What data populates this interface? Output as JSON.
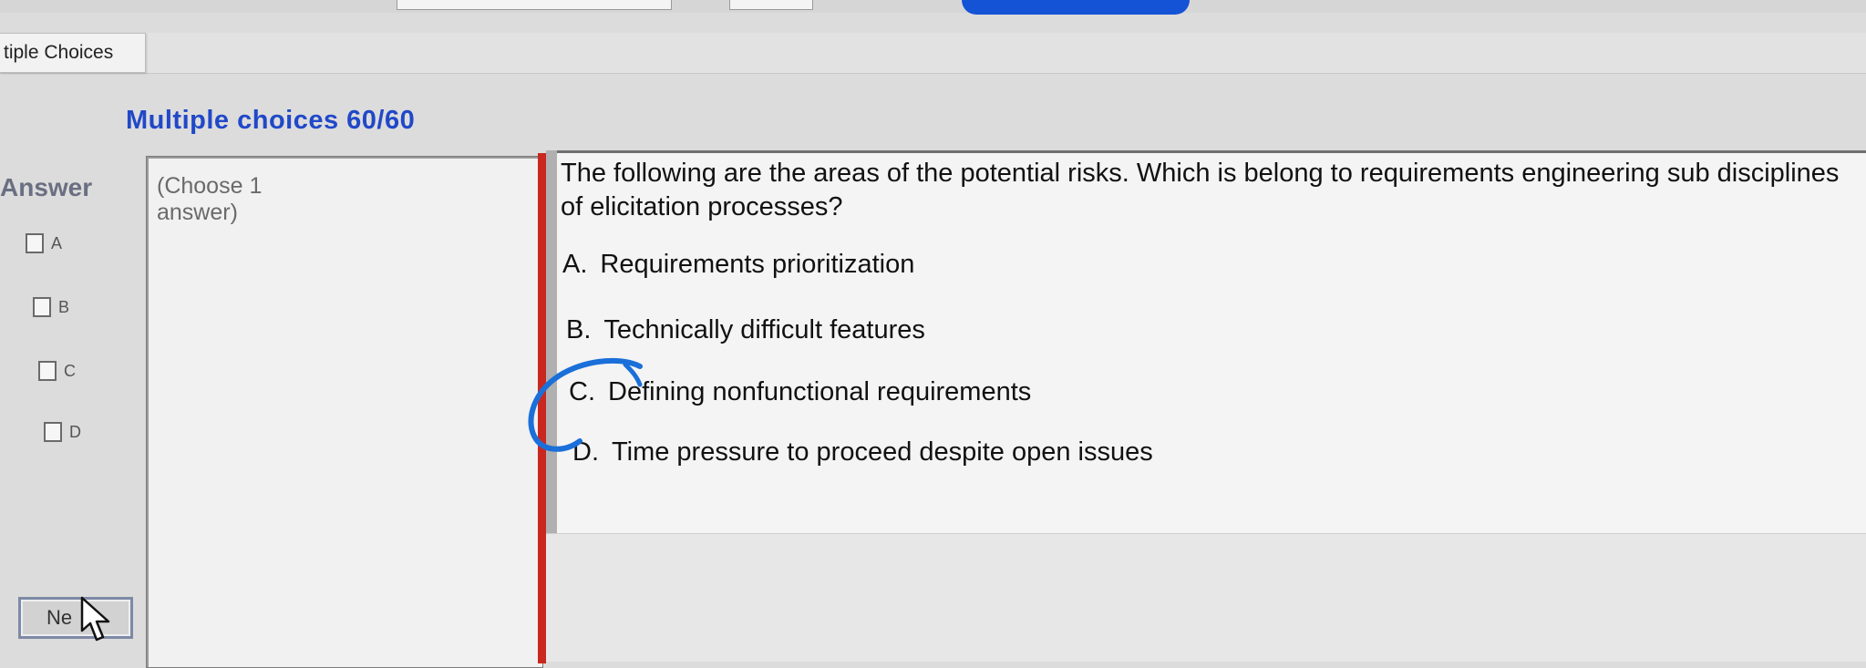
{
  "tab": {
    "label": "tiple Choices"
  },
  "section": {
    "title": "Multiple choices 60/60"
  },
  "answer_panel": {
    "label": "Answer",
    "options": [
      {
        "letter": "A"
      },
      {
        "letter": "B"
      },
      {
        "letter": "C"
      },
      {
        "letter": "D"
      }
    ],
    "next_label": "Ne"
  },
  "instruction": {
    "text": "(Choose 1 answer)"
  },
  "question": {
    "text": "The following are the areas of the potential risks. Which is belong to requirements engineering sub disciplines of elicitation processes?",
    "choices": [
      {
        "letter": "A.",
        "text": "Requirements prioritization"
      },
      {
        "letter": "B.",
        "text": "Technically difficult features"
      },
      {
        "letter": "C.",
        "text": "Defining nonfunctional requirements"
      },
      {
        "letter": "D.",
        "text": "Time pressure to proceed despite open issues"
      }
    ]
  },
  "colors": {
    "title_blue": "#2048c8",
    "separator_red": "#c8281f",
    "annotation_blue": "#1a6fd9"
  }
}
